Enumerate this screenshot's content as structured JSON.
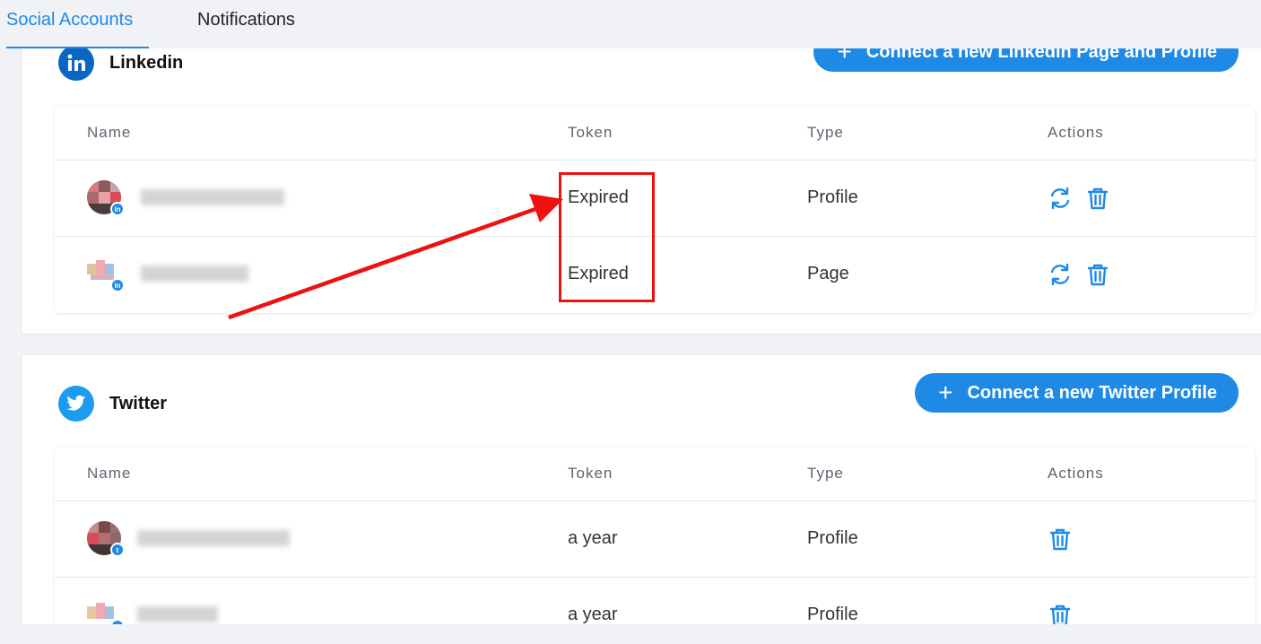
{
  "tabs": [
    {
      "label": "Social Accounts",
      "active": true
    },
    {
      "label": "Notifications",
      "active": false
    }
  ],
  "linkedin": {
    "title": "Linkedin",
    "icon": "linkedin-icon",
    "connect_label": "Connect a new Linkedin Page and Profile",
    "columns": [
      "Name",
      "Token",
      "Type",
      "Actions"
    ],
    "rows": [
      {
        "token": "Expired",
        "type": "Profile",
        "actions": [
          "refresh-icon",
          "trash-icon"
        ]
      },
      {
        "token": "Expired",
        "type": "Page",
        "actions": [
          "refresh-icon",
          "trash-icon"
        ]
      }
    ]
  },
  "twitter": {
    "title": "Twitter",
    "icon": "twitter-icon",
    "connect_label": "Connect a new Twitter Profile",
    "columns": [
      "Name",
      "Token",
      "Type",
      "Actions"
    ],
    "rows": [
      {
        "token": "a year",
        "type": "Profile",
        "actions": [
          "trash-icon"
        ]
      },
      {
        "token": "a year",
        "type": "Profile",
        "actions": [
          "trash-icon"
        ]
      }
    ]
  },
  "colors": {
    "accent": "#1e8ae6",
    "annotation": "#ee1111",
    "background": "#f1f2f5"
  }
}
